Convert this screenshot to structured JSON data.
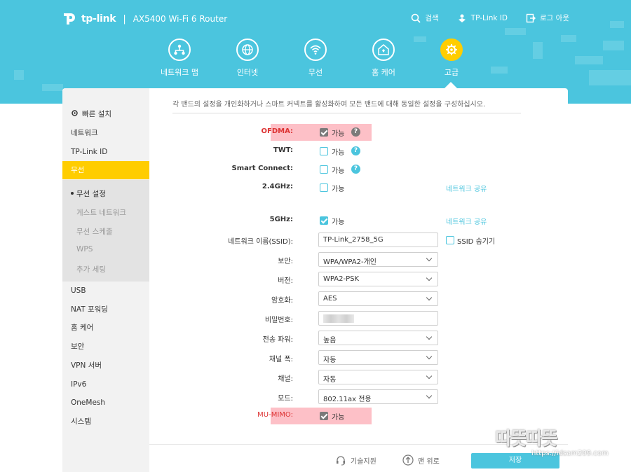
{
  "header": {
    "brand": "tp-link",
    "separator": "|",
    "model": "AX5400 Wi-Fi 6 Router",
    "links": {
      "search": "검색",
      "tplink_id": "TP-Link ID",
      "logout": "로그 아웃"
    }
  },
  "nav": {
    "items": [
      {
        "label": "네트워크 맵",
        "icon": "network-map-icon"
      },
      {
        "label": "인터넷",
        "icon": "globe-icon"
      },
      {
        "label": "무선",
        "icon": "wifi-icon"
      },
      {
        "label": "홈 케어",
        "icon": "home-care-icon"
      },
      {
        "label": "고급",
        "icon": "gear-icon",
        "active": true
      }
    ]
  },
  "sidebar": {
    "items": [
      {
        "label": "빠른 설치",
        "icon": "quick-setup-icon"
      },
      {
        "label": "네트워크"
      },
      {
        "label": "TP-Link ID"
      },
      {
        "label": "무선",
        "active": true
      },
      {
        "label": "USB"
      },
      {
        "label": "NAT 포워딩"
      },
      {
        "label": "홈 케어"
      },
      {
        "label": "보안"
      },
      {
        "label": "VPN 서버"
      },
      {
        "label": "IPv6"
      },
      {
        "label": "OneMesh"
      },
      {
        "label": "시스템"
      }
    ],
    "sub_items": [
      {
        "label": "무선 설정",
        "active": true
      },
      {
        "label": "게스트 네트워크"
      },
      {
        "label": "무선 스케줄"
      },
      {
        "label": "WPS"
      },
      {
        "label": "추가 세팅"
      }
    ]
  },
  "main": {
    "description": "각 밴드의 설정을 개인화하거나 스마트 커넥트를 활성화하여 모든 밴드에 대해 동일한 설정을 구성하십시오.",
    "ofdma": {
      "label": "OFDMA:",
      "checkbox_label": "가능",
      "checked": true
    },
    "twt": {
      "label": "TWT:",
      "checkbox_label": "가능",
      "checked": false
    },
    "smart_connect": {
      "label": "Smart Connect:",
      "checkbox_label": "가능",
      "checked": false
    },
    "band_24": {
      "label": "2.4GHz:",
      "checkbox_label": "가능",
      "checked": false,
      "share": "네트워크 공유"
    },
    "band_5": {
      "label": "5GHz:",
      "checkbox_label": "가능",
      "checked": true,
      "share": "네트워크 공유"
    },
    "ssid": {
      "label": "네트워크 이름(SSID):",
      "value": "TP-Link_2758_5G",
      "hide_label": "SSID 숨기기"
    },
    "security": {
      "label": "보안:",
      "value": "WPA/WPA2-개인"
    },
    "version": {
      "label": "버전:",
      "value": "WPA2-PSK"
    },
    "encryption": {
      "label": "암호화:",
      "value": "AES"
    },
    "password": {
      "label": "비밀번호:"
    },
    "tx_power": {
      "label": "전송 파워:",
      "value": "높음"
    },
    "channel_width": {
      "label": "채널 폭:",
      "value": "자동"
    },
    "channel": {
      "label": "채널:",
      "value": "자동"
    },
    "mode": {
      "label": "모드:",
      "value": "802.11ax 전용"
    },
    "mu_mimo": {
      "label": "MU-MIMO:",
      "checkbox_label": "가능",
      "checked": true
    }
  },
  "footer": {
    "support": "기술지원",
    "top": "맨 위로",
    "save": "저장"
  },
  "watermark": {
    "text": "따뜻따뜻",
    "url": "https://idsam209.com"
  },
  "colors": {
    "brand": "#4bc5de",
    "active": "#ffcd00",
    "highlight": "#fdc0c7"
  }
}
